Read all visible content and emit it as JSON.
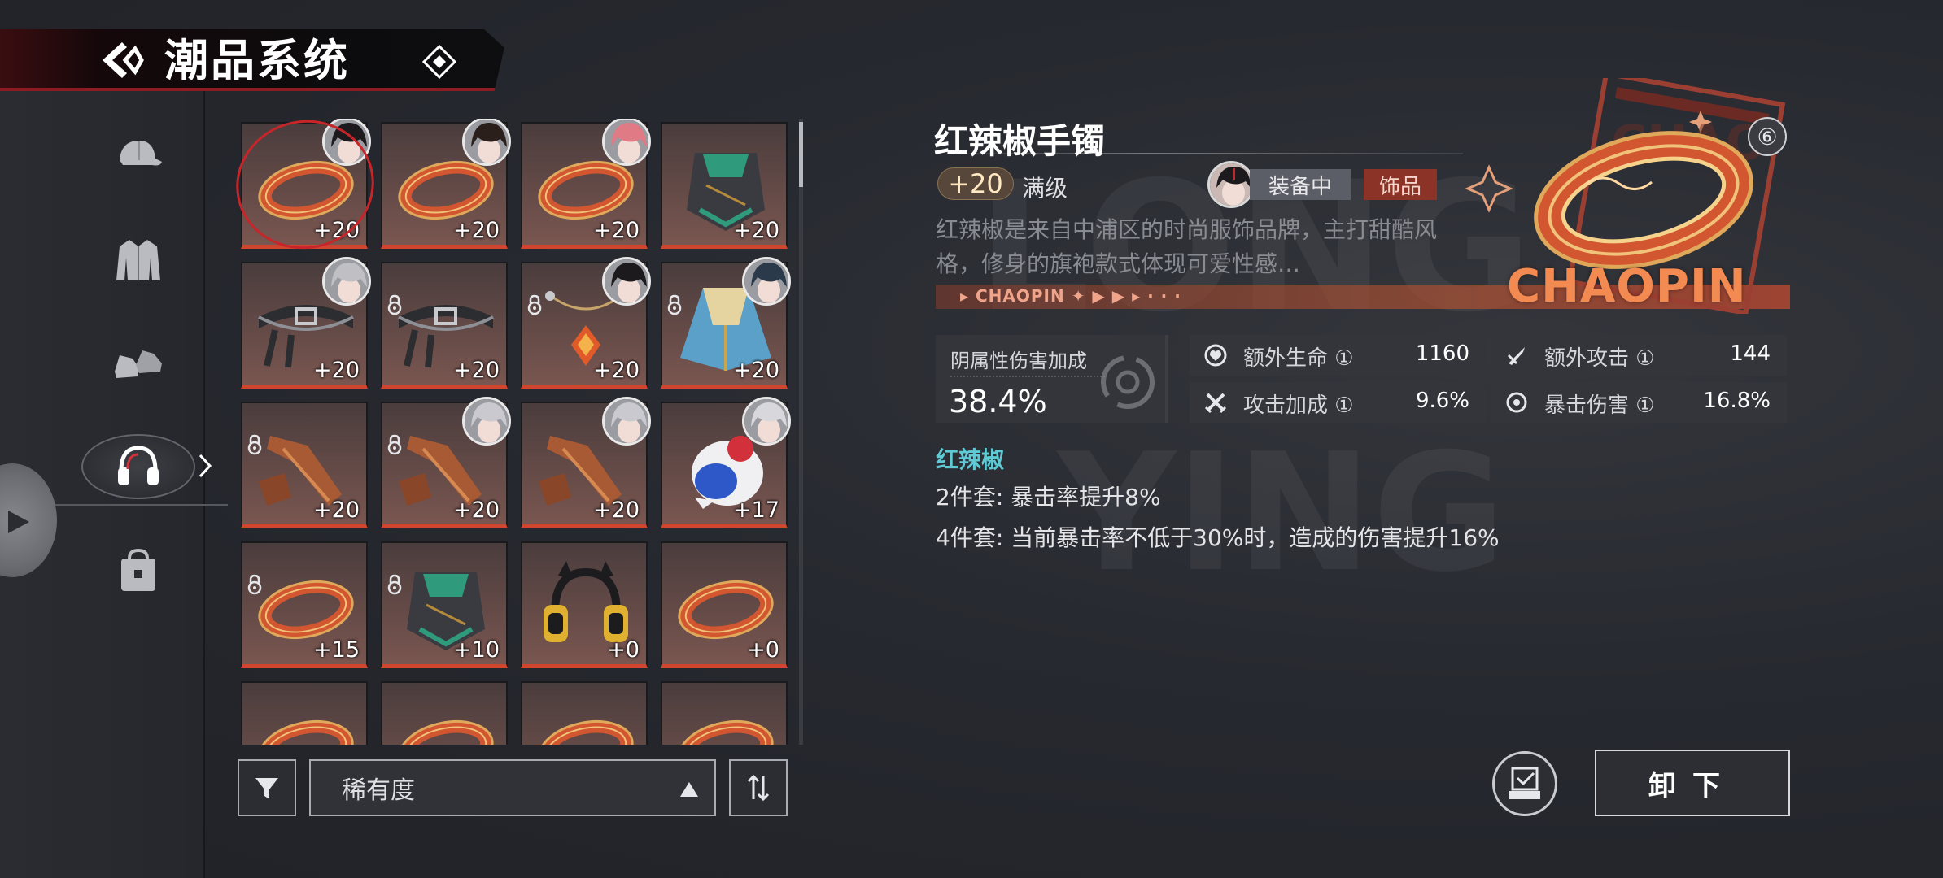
{
  "header": {
    "title": "潮品系统",
    "back_icon": "back-arrow-icon",
    "menu_icon": "diamond-icon"
  },
  "sidebar": {
    "items": [
      {
        "name": "cap",
        "icon": "cap-icon"
      },
      {
        "name": "jacket",
        "icon": "jacket-icon"
      },
      {
        "name": "shoes",
        "icon": "sneakers-icon"
      },
      {
        "name": "headphones",
        "icon": "headphones-icon",
        "active": true
      },
      {
        "name": "bag",
        "icon": "bag-icon"
      }
    ]
  },
  "grid": {
    "items": [
      {
        "type": "bracelet",
        "level": "+20",
        "avatar": true,
        "selected": true
      },
      {
        "type": "bracelet",
        "level": "+20",
        "avatar": true
      },
      {
        "type": "bracelet",
        "level": "+20",
        "avatar": true
      },
      {
        "type": "scarf",
        "level": "+20"
      },
      {
        "type": "belt",
        "level": "+20",
        "avatar": true
      },
      {
        "type": "belt",
        "level": "+20",
        "locked": true
      },
      {
        "type": "necklace",
        "level": "+20",
        "locked": true,
        "avatar": true
      },
      {
        "type": "cape",
        "level": "+20",
        "locked": true,
        "avatar": true
      },
      {
        "type": "tie",
        "level": "+20",
        "locked": true
      },
      {
        "type": "tie",
        "level": "+20",
        "locked": true,
        "avatar": true
      },
      {
        "type": "tie",
        "level": "+20",
        "avatar": true
      },
      {
        "type": "plush",
        "level": "+17",
        "avatar": true
      },
      {
        "type": "bracelet",
        "level": "+15",
        "locked": true
      },
      {
        "type": "scarf",
        "level": "+10",
        "locked": true
      },
      {
        "type": "headphones",
        "level": "+0"
      },
      {
        "type": "bracelet",
        "level": "+0"
      },
      {
        "type": "bracelet",
        "level": ""
      },
      {
        "type": "bracelet",
        "level": ""
      },
      {
        "type": "bracelet",
        "level": ""
      },
      {
        "type": "bracelet",
        "level": ""
      }
    ]
  },
  "sort": {
    "label": "稀有度",
    "filter_icon": "filter-icon",
    "order_icon": "sort-order-icon"
  },
  "detail": {
    "name": "红辣椒手镯",
    "level": "+20",
    "level_status": "满级",
    "equip_status": "装备中",
    "type_tag": "饰品",
    "description": "红辣椒是来自中浦区的时尚服饰品牌，主打甜酷风格，修身的旗袍款式体现可爱性感…",
    "band_text": "▸ CHAOPIN ✦ ▶ ▶ ▸ · · ·",
    "brand": "CHAOPIN",
    "refine": "⑥",
    "main_stat": {
      "label": "阴属性伤害加成",
      "value": "38.4%"
    },
    "sub_stats": [
      {
        "label": "额外生命 ①",
        "value": "1160",
        "icon": "heart-shield-icon"
      },
      {
        "label": "额外攻击 ①",
        "value": "144",
        "icon": "sword-icon"
      },
      {
        "label": "攻击加成 ①",
        "value": "9.6%",
        "icon": "crossed-swords-icon"
      },
      {
        "label": "暴击伤害 ①",
        "value": "16.8%",
        "icon": "crit-target-icon"
      }
    ],
    "set_name": "红辣椒",
    "set_bonus": [
      "2件套: 暴击率提升8%",
      "4件套: 当前暴击率不低于30%时，造成的伤害提升16%"
    ]
  },
  "actions": {
    "unequip": "卸下",
    "compare_icon": "compare-checklist-icon"
  },
  "colors": {
    "accent_red": "#c8252b",
    "cyan": "#5fc9d4",
    "card_bottom": "#d0452d",
    "brand_orange": "#f28a52"
  }
}
